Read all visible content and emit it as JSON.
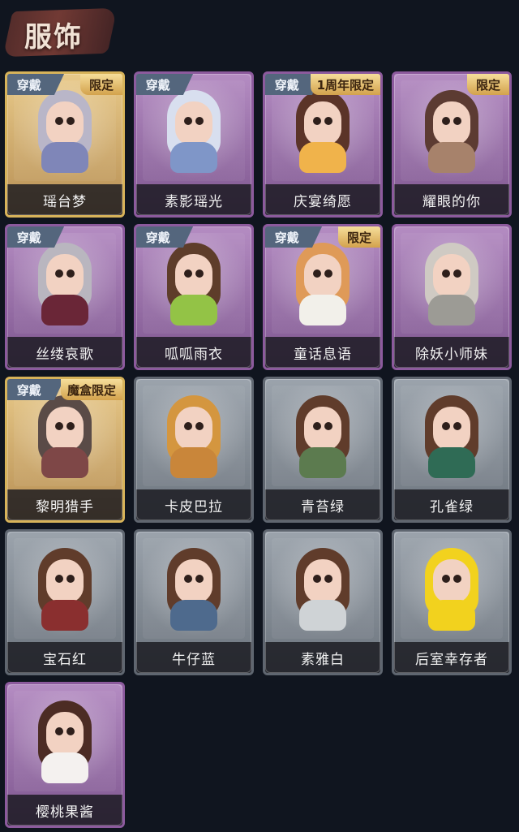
{
  "header": {
    "title": "服饰"
  },
  "costumes": [
    {
      "name": "瑶台梦",
      "style": "gold",
      "worn": true,
      "badge": "限定",
      "hair_color": "#b9b6c8",
      "outfit_color": "#7f86b8"
    },
    {
      "name": "素影瑶光",
      "style": "purple",
      "worn": true,
      "badge": "",
      "hair_color": "#d8dfef",
      "outfit_color": "#7f96c8"
    },
    {
      "name": "庆宴绮愿",
      "style": "purple",
      "worn": true,
      "badge": "1周年限定",
      "hair_color": "#5b3428",
      "outfit_color": "#f0b34b"
    },
    {
      "name": "耀眼的你",
      "style": "purple",
      "worn": false,
      "badge": "限定",
      "hair_color": "#5c3b32",
      "outfit_color": "#a7826b"
    },
    {
      "name": "丝缕哀歌",
      "style": "purple",
      "worn": true,
      "badge": "",
      "hair_color": "#b9b6bf",
      "outfit_color": "#6a2637"
    },
    {
      "name": "呱呱雨衣",
      "style": "purple",
      "worn": true,
      "badge": "",
      "hair_color": "#5e3d2a",
      "outfit_color": "#93c346"
    },
    {
      "name": "童话息语",
      "style": "purple",
      "worn": true,
      "badge": "限定",
      "hair_color": "#df9a58",
      "outfit_color": "#f2f0ea"
    },
    {
      "name": "除妖小师妹",
      "style": "purple",
      "worn": false,
      "badge": "",
      "hair_color": "#cfcac3",
      "outfit_color": "#9c9b95"
    },
    {
      "name": "黎明猎手",
      "style": "gold",
      "worn": true,
      "badge": "魔盒限定",
      "hair_color": "#5a4b47",
      "outfit_color": "#7e4747"
    },
    {
      "name": "卡皮巴拉",
      "style": "gray",
      "worn": false,
      "badge": "",
      "hair_color": "#d4963f",
      "outfit_color": "#c9863a"
    },
    {
      "name": "青苔绿",
      "style": "gray",
      "worn": false,
      "badge": "",
      "hair_color": "#603c2b",
      "outfit_color": "#5c7b4f"
    },
    {
      "name": "孔雀绿",
      "style": "gray",
      "worn": false,
      "badge": "",
      "hair_color": "#603c2b",
      "outfit_color": "#2f6b55"
    },
    {
      "name": "宝石红",
      "style": "gray",
      "worn": false,
      "badge": "",
      "hair_color": "#603c2b",
      "outfit_color": "#8a2f2f"
    },
    {
      "name": "牛仔蓝",
      "style": "gray",
      "worn": false,
      "badge": "",
      "hair_color": "#603c2b",
      "outfit_color": "#4e6a8d"
    },
    {
      "name": "素雅白",
      "style": "gray",
      "worn": false,
      "badge": "",
      "hair_color": "#603c2b",
      "outfit_color": "#cfd3d6"
    },
    {
      "name": "后室幸存者",
      "style": "gray",
      "worn": false,
      "badge": "",
      "hair_color": "#f2d21e",
      "outfit_color": "#f2d21e"
    },
    {
      "name": "樱桃果酱",
      "style": "purple",
      "worn": false,
      "badge": "",
      "hair_color": "#4c2c24",
      "outfit_color": "#f4f1ef"
    }
  ],
  "labels": {
    "worn": "穿戴"
  }
}
